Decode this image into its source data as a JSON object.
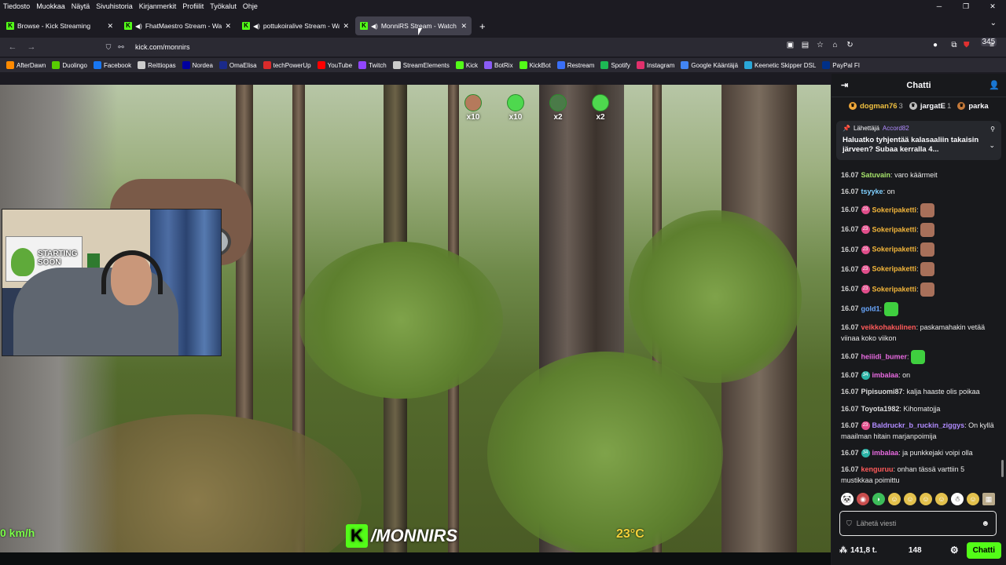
{
  "menubar": [
    "Tiedosto",
    "Muokkaa",
    "Näytä",
    "Sivuhistoria",
    "Kirjanmerkit",
    "Profiilit",
    "Työkalut",
    "Ohje"
  ],
  "tabs": [
    {
      "title": "Browse - Kick Streaming",
      "audio": false,
      "active": false
    },
    {
      "title": "FhatMaestro Stream - Watch",
      "audio": true,
      "active": false
    },
    {
      "title": "pottukoiralive Stream - Watch",
      "audio": true,
      "active": false
    },
    {
      "title": "MonniRS Stream - Watch",
      "audio": true,
      "active": true
    }
  ],
  "address": {
    "url": "kick.com/monnirs"
  },
  "toolbar": {
    "extensions_badge": "345"
  },
  "bookmarks": [
    {
      "label": "AfterDawn",
      "color": "#ff8a00"
    },
    {
      "label": "Duolingo",
      "color": "#58cc02"
    },
    {
      "label": "Facebook",
      "color": "#1877f2"
    },
    {
      "label": "Reittiopas",
      "color": "#cccccc"
    },
    {
      "label": "Nordea",
      "color": "#0000a0"
    },
    {
      "label": "OmaElisa",
      "color": "#1a2a8a"
    },
    {
      "label": "techPowerUp",
      "color": "#d92b2b"
    },
    {
      "label": "YouTube",
      "color": "#ff0000"
    },
    {
      "label": "Twitch",
      "color": "#9146ff"
    },
    {
      "label": "StreamElements",
      "color": "#cccccc"
    },
    {
      "label": "Kick",
      "color": "#53fc18"
    },
    {
      "label": "BotRix",
      "color": "#8a5cf6"
    },
    {
      "label": "KickBot",
      "color": "#53fc18"
    },
    {
      "label": "Restream",
      "color": "#3a6ff7"
    },
    {
      "label": "Spotify",
      "color": "#1db954"
    },
    {
      "label": "Instagram",
      "color": "#e1306c"
    },
    {
      "label": "Google Kääntäjä",
      "color": "#4285f4"
    },
    {
      "label": "Keenetic Skipper DSL",
      "color": "#2aa7d8"
    },
    {
      "label": "PayPal FI",
      "color": "#003087"
    }
  ],
  "video": {
    "speed": "0 km/h",
    "logo_text": "/MONNIRS",
    "temperature": "23°C",
    "webcam_poster_text": "STARTING SOON",
    "overlay_counts": [
      "x10",
      "x10",
      "x2",
      "x2"
    ]
  },
  "chat": {
    "title": "Chatti",
    "gifters": [
      {
        "name": "dogman76",
        "count": "3"
      },
      {
        "name": "jargatE",
        "count": "1"
      },
      {
        "name": "parka",
        "count": ""
      }
    ],
    "pinned": {
      "label": "Lähettäjä",
      "by": "Accord82",
      "text": "Haluatko tyhjentää kalasaaliin takaisin järveen? Subaa kerralla 4..."
    },
    "messages": [
      {
        "time": "16.07",
        "user": "Satuvain",
        "color": "#a6e36b",
        "badge": "",
        "text": "varo käärmeit"
      },
      {
        "time": "16.07",
        "user": "tsyyke",
        "color": "#7fd0ff",
        "badge": "",
        "text": "on"
      },
      {
        "time": "16.07",
        "user": "Sokeripaketti",
        "color": "#f4b63b",
        "badge": "23",
        "text": ""
      },
      {
        "time": "16.07",
        "user": "Sokeripaketti",
        "color": "#f4b63b",
        "badge": "23",
        "text": ""
      },
      {
        "time": "16.07",
        "user": "Sokeripaketti",
        "color": "#f4b63b",
        "badge": "23",
        "text": ""
      },
      {
        "time": "16.07",
        "user": "Sokeripaketti",
        "color": "#f4b63b",
        "badge": "23",
        "text": ""
      },
      {
        "time": "16.07",
        "user": "Sokeripaketti",
        "color": "#f4b63b",
        "badge": "23",
        "text": ""
      },
      {
        "time": "16.07",
        "user": "gold1",
        "color": "#6aa8ff",
        "badge": "",
        "text": ""
      },
      {
        "time": "16.07",
        "user": "veikkohakulinen",
        "color": "#ff5a5a",
        "badge": "",
        "text": "paskamahakin vetää viinaa koko viikon"
      },
      {
        "time": "16.07",
        "user": "heiiidi_bumer",
        "color": "#e86ae0",
        "badge": "",
        "text": ""
      },
      {
        "time": "16.07",
        "user": "imbalaa",
        "color": "#e86ae0",
        "badge": "34",
        "text": "on"
      },
      {
        "time": "16.07",
        "user": "Pipisuomi87",
        "color": "#dddddd",
        "badge": "",
        "text": "kalja haaste olis poikaa"
      },
      {
        "time": "16.07",
        "user": "Toyota1982",
        "color": "#dddddd",
        "badge": "",
        "text": "Kihomatojja"
      },
      {
        "time": "16.07",
        "user": "Baldruckr_b_ruckin_ziggys",
        "color": "#b18cff",
        "badge": "23",
        "text": "On kyllä maailman hitain marjanpoimija"
      },
      {
        "time": "16.07",
        "user": "imbalaa",
        "color": "#e86ae0",
        "badge": "34",
        "text": "ja punkkejaki voipi olla"
      },
      {
        "time": "16.07",
        "user": "kenguruu",
        "color": "#ff5a5a",
        "badge": "",
        "text": "onhan tässä varttiin 5 mustikkaa poimittu"
      }
    ],
    "input_placeholder": "Lähetä viesti",
    "points": "141,8 t.",
    "viewers": "148",
    "send_label": "Chatti"
  },
  "colors": {
    "kick_green": "#53fc18",
    "chat_bg": "#18191c",
    "browser_bg": "#1c1b22"
  }
}
